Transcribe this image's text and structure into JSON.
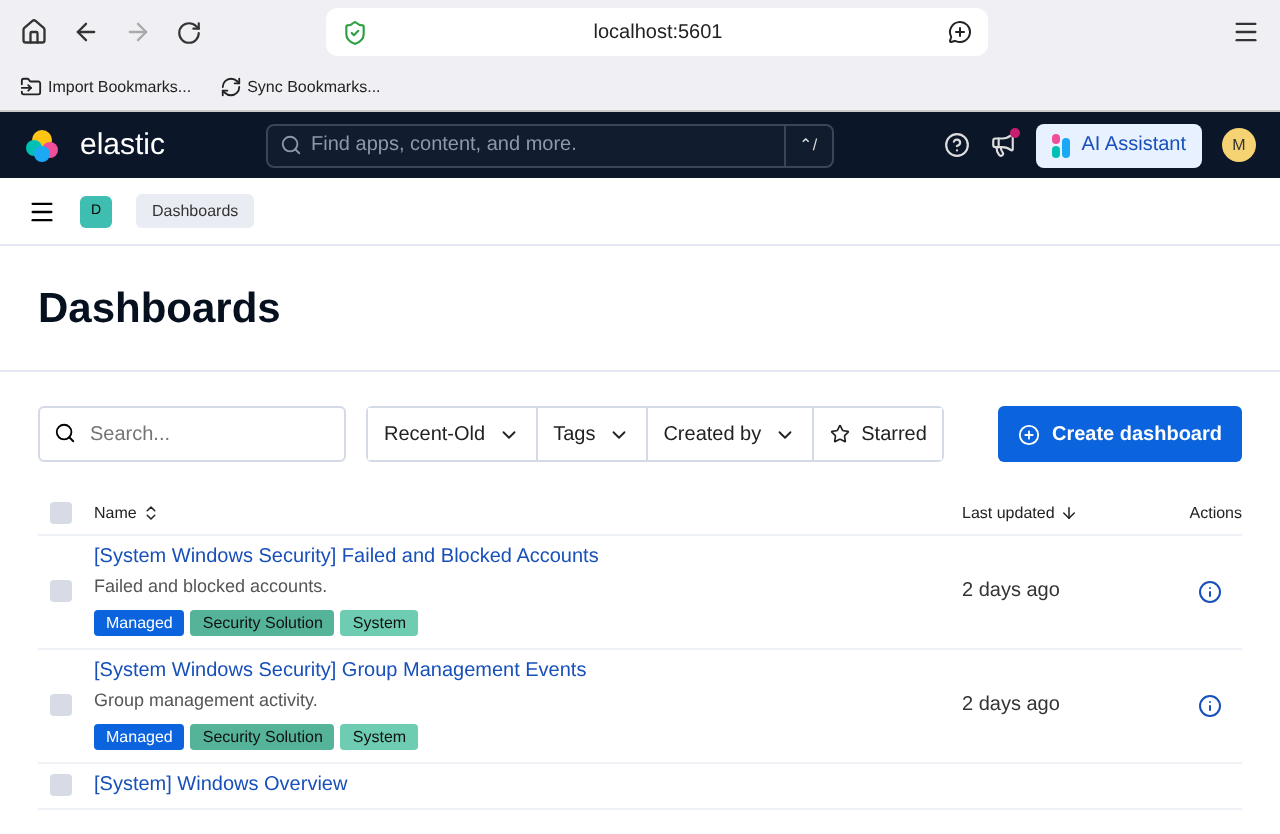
{
  "browser": {
    "url": "localhost:5601",
    "bookmarks": [
      "Import Bookmarks...",
      "Sync Bookmarks..."
    ]
  },
  "header": {
    "logo": "elastic",
    "search_placeholder": "Find apps, content, and more.",
    "shortcut": "⌃/",
    "assistant": "AI Assistant",
    "avatar": "M",
    "has_notification": true
  },
  "breadcrumbs": {
    "space": "D",
    "items": [
      "Dashboards"
    ]
  },
  "page_title": "Dashboards",
  "toolbar": {
    "search_placeholder": "Search...",
    "filters": [
      {
        "label": "Recent-Old",
        "kind": "dropdown"
      },
      {
        "label": "Tags",
        "kind": "dropdown"
      },
      {
        "label": "Created by",
        "kind": "dropdown"
      },
      {
        "label": "Starred",
        "kind": "star"
      }
    ],
    "create_button": "Create dashboard"
  },
  "table": {
    "select_all_checked": false,
    "columns": [
      "Name",
      "Last updated",
      "Actions"
    ],
    "rows": [
      {
        "title": "[System Windows Security] Failed and Blocked Accounts",
        "description": "Failed and blocked accounts.",
        "updated": "2 days ago",
        "checked": false,
        "tags": [
          {
            "label": "Managed",
            "color": "#0b64dd"
          },
          {
            "label": "Security Solution",
            "color": "#54b399"
          },
          {
            "label": "System",
            "color": "#6dccb1"
          }
        ]
      },
      {
        "title": "[System Windows Security] Group Management Events",
        "description": "Group management activity.",
        "updated": "2 days ago",
        "checked": false,
        "tags": [
          {
            "label": "Managed",
            "color": "#0b64dd"
          },
          {
            "label": "Security Solution",
            "color": "#54b399"
          },
          {
            "label": "System",
            "color": "#6dccb1"
          }
        ]
      },
      {
        "title": "[System] Windows Overview",
        "checked": false
      }
    ]
  }
}
